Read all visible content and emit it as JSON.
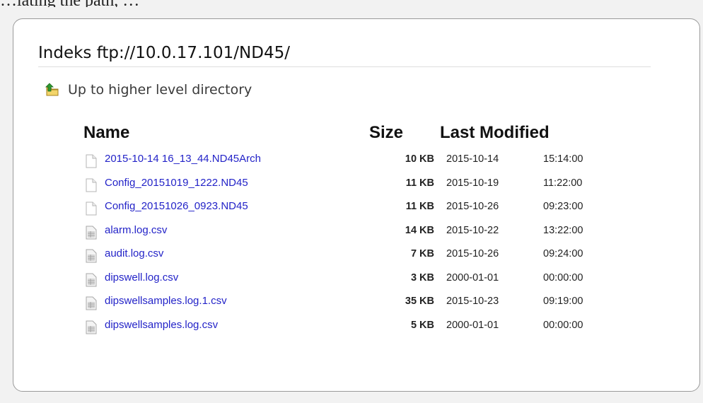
{
  "header_fragment": "…lating the path, …",
  "title": "Indeks ftp://10.0.17.101/ND45/",
  "up_link": {
    "label": "Up to higher level directory",
    "icon": "folder-up-icon"
  },
  "columns": {
    "name": "Name",
    "size": "Size",
    "last_modified": "Last Modified"
  },
  "colors": {
    "link": "#2323c8",
    "panel_border": "#9a9a9a"
  },
  "files": [
    {
      "name": "2015-10-14 16_13_44.ND45Arch",
      "size": "10 KB",
      "date": "2015-10-14",
      "time": "15:14:00",
      "icon": "blank-file-icon"
    },
    {
      "name": "Config_20151019_1222.ND45",
      "size": "11 KB",
      "date": "2015-10-19",
      "time": "11:22:00",
      "icon": "blank-file-icon"
    },
    {
      "name": "Config_20151026_0923.ND45",
      "size": "11 KB",
      "date": "2015-10-26",
      "time": "09:23:00",
      "icon": "blank-file-icon"
    },
    {
      "name": "alarm.log.csv",
      "size": "14 KB",
      "date": "2015-10-22",
      "time": "13:22:00",
      "icon": "spreadsheet-file-icon"
    },
    {
      "name": "audit.log.csv",
      "size": "7 KB",
      "date": "2015-10-26",
      "time": "09:24:00",
      "icon": "spreadsheet-file-icon"
    },
    {
      "name": "dipswell.log.csv",
      "size": "3 KB",
      "date": "2000-01-01",
      "time": "00:00:00",
      "icon": "spreadsheet-file-icon"
    },
    {
      "name": "dipswellsamples.log.1.csv",
      "size": "35 KB",
      "date": "2015-10-23",
      "time": "09:19:00",
      "icon": "spreadsheet-file-icon"
    },
    {
      "name": "dipswellsamples.log.csv",
      "size": "5 KB",
      "date": "2000-01-01",
      "time": "00:00:00",
      "icon": "spreadsheet-file-icon"
    }
  ]
}
